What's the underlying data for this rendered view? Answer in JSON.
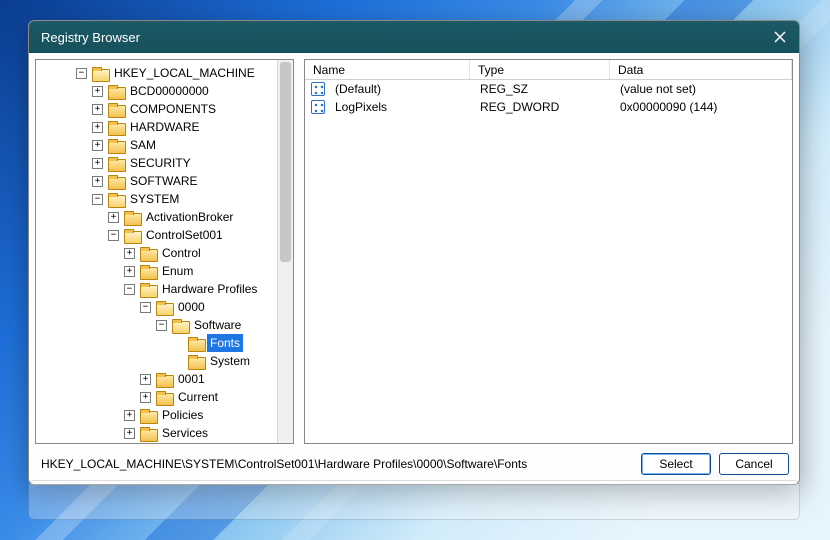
{
  "window": {
    "title": "Registry Browser"
  },
  "tree": [
    {
      "depth": 0,
      "toggle": "minus",
      "open": true,
      "label": "HKEY_LOCAL_MACHINE",
      "selected": false
    },
    {
      "depth": 1,
      "toggle": "plus",
      "open": false,
      "label": "BCD00000000",
      "selected": false
    },
    {
      "depth": 1,
      "toggle": "plus",
      "open": false,
      "label": "COMPONENTS",
      "selected": false
    },
    {
      "depth": 1,
      "toggle": "plus",
      "open": false,
      "label": "HARDWARE",
      "selected": false
    },
    {
      "depth": 1,
      "toggle": "plus",
      "open": false,
      "label": "SAM",
      "selected": false
    },
    {
      "depth": 1,
      "toggle": "plus",
      "open": false,
      "label": "SECURITY",
      "selected": false
    },
    {
      "depth": 1,
      "toggle": "plus",
      "open": false,
      "label": "SOFTWARE",
      "selected": false
    },
    {
      "depth": 1,
      "toggle": "minus",
      "open": true,
      "label": "SYSTEM",
      "selected": false
    },
    {
      "depth": 2,
      "toggle": "plus",
      "open": false,
      "label": "ActivationBroker",
      "selected": false
    },
    {
      "depth": 2,
      "toggle": "minus",
      "open": true,
      "label": "ControlSet001",
      "selected": false
    },
    {
      "depth": 3,
      "toggle": "plus",
      "open": false,
      "label": "Control",
      "selected": false
    },
    {
      "depth": 3,
      "toggle": "plus",
      "open": false,
      "label": "Enum",
      "selected": false
    },
    {
      "depth": 3,
      "toggle": "minus",
      "open": true,
      "label": "Hardware Profiles",
      "selected": false
    },
    {
      "depth": 4,
      "toggle": "minus",
      "open": true,
      "label": "0000",
      "selected": false
    },
    {
      "depth": 5,
      "toggle": "minus",
      "open": true,
      "label": "Software",
      "selected": false
    },
    {
      "depth": 6,
      "toggle": "none",
      "open": false,
      "label": "Fonts",
      "selected": true
    },
    {
      "depth": 6,
      "toggle": "none",
      "open": false,
      "label": "System",
      "selected": false
    },
    {
      "depth": 4,
      "toggle": "plus",
      "open": false,
      "label": "0001",
      "selected": false
    },
    {
      "depth": 4,
      "toggle": "plus",
      "open": false,
      "label": "Current",
      "selected": false
    },
    {
      "depth": 3,
      "toggle": "plus",
      "open": false,
      "label": "Policies",
      "selected": false
    },
    {
      "depth": 3,
      "toggle": "plus",
      "open": false,
      "label": "Services",
      "selected": false
    }
  ],
  "list": {
    "columns": {
      "name": "Name",
      "type": "Type",
      "data": "Data"
    },
    "rows": [
      {
        "name": "(Default)",
        "type": "REG_SZ",
        "data": "(value not set)"
      },
      {
        "name": "LogPixels",
        "type": "REG_DWORD",
        "data": "0x00000090 (144)"
      }
    ]
  },
  "footer": {
    "path": "HKEY_LOCAL_MACHINE\\SYSTEM\\ControlSet001\\Hardware Profiles\\0000\\Software\\Fonts",
    "select": "Select",
    "cancel": "Cancel"
  }
}
